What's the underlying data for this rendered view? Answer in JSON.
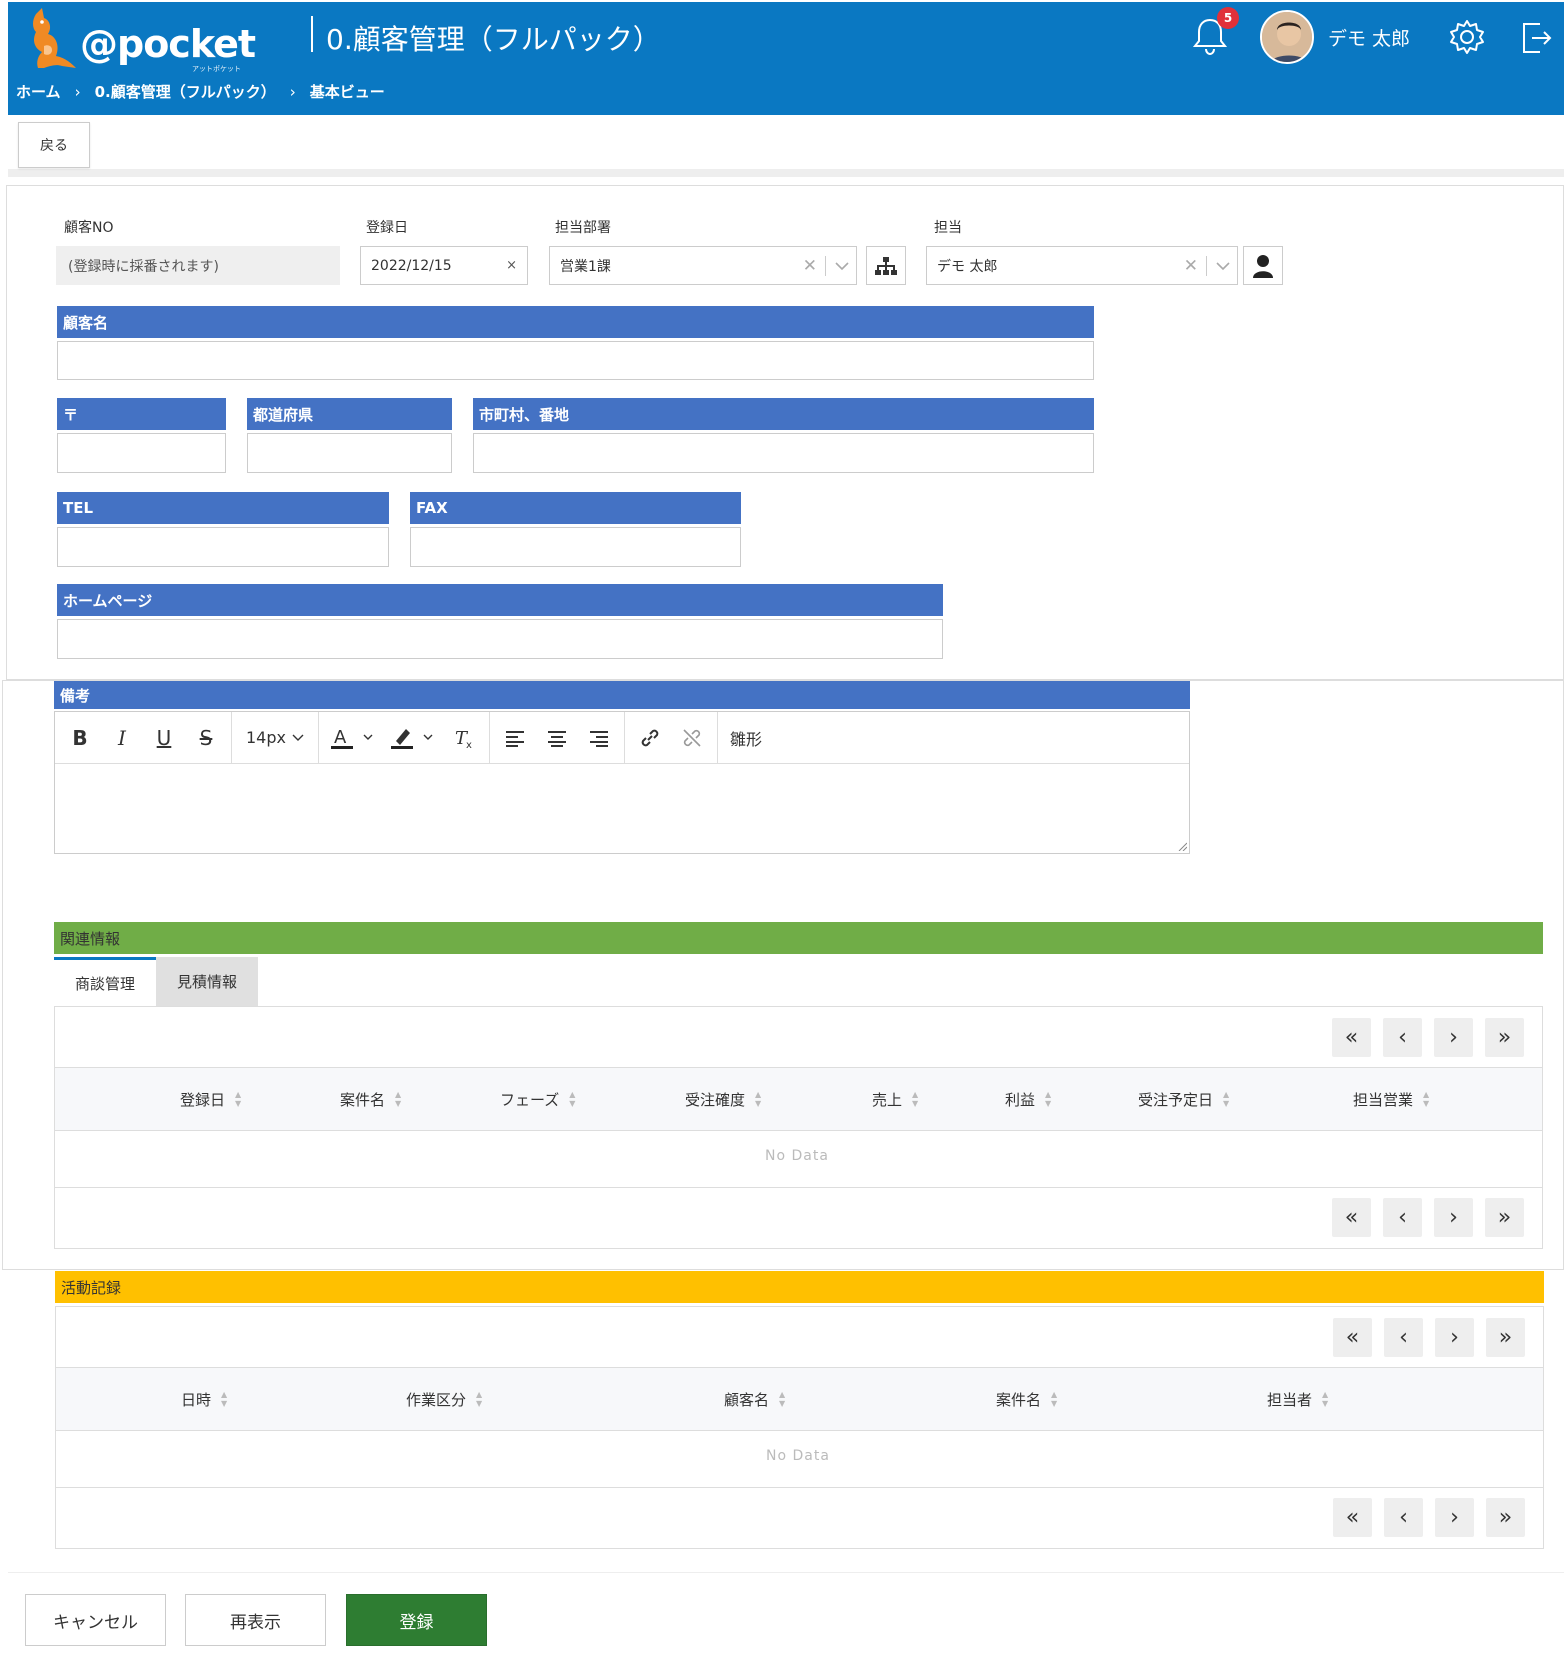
{
  "header": {
    "logo_text": "@pocket",
    "logo_sub": "アットポケット",
    "app_title": "0.顧客管理（フルパック）",
    "breadcrumb": [
      "ホーム",
      "0.顧客管理（フルパック）",
      "基本ビュー"
    ],
    "notification_count": "5",
    "user_name": "デモ 太郎",
    "colors": {
      "header_bg": "#0a78c2",
      "badge": "#e0313a"
    }
  },
  "toolbar": {
    "back_label": "戻る"
  },
  "form": {
    "customer_no": {
      "label": "顧客NO",
      "value": "(登録時に採番されます)"
    },
    "reg_date": {
      "label": "登録日",
      "value": "2022/12/15",
      "clear": "×"
    },
    "department": {
      "label": "担当部署",
      "value": "営業1課"
    },
    "owner": {
      "label": "担当",
      "value": "デモ 太郎"
    },
    "customer_name": {
      "label": "顧客名",
      "value": ""
    },
    "zip": {
      "label": "〒",
      "value": ""
    },
    "prefecture": {
      "label": "都道府県",
      "value": ""
    },
    "address": {
      "label": "市町村、番地",
      "value": ""
    },
    "tel": {
      "label": "TEL",
      "value": ""
    },
    "fax": {
      "label": "FAX",
      "value": ""
    },
    "homepage": {
      "label": "ホームページ",
      "value": ""
    },
    "notes": {
      "label": "備考",
      "value": ""
    }
  },
  "editor": {
    "font_size": "14px",
    "template_label": "雛形",
    "buttons": [
      "bold",
      "italic",
      "underline",
      "strikethrough",
      "font-color",
      "highlight",
      "clear-format",
      "align-left",
      "align-center",
      "align-right",
      "link",
      "unlink"
    ]
  },
  "related": {
    "title": "関連情報",
    "tabs": [
      {
        "label": "商談管理",
        "active": true
      },
      {
        "label": "見積情報",
        "active": false
      }
    ],
    "columns": [
      "登録日",
      "案件名",
      "フェーズ",
      "受注確度",
      "売上",
      "利益",
      "受注予定日",
      "担当営業"
    ],
    "empty_text": "No Data"
  },
  "activity": {
    "title": "活動記録",
    "columns": [
      "日時",
      "作業区分",
      "顧客名",
      "案件名",
      "担当者"
    ],
    "empty_text": "No Data"
  },
  "pager": {
    "first": "«",
    "prev": "‹",
    "next": "›",
    "last": "»"
  },
  "footer": {
    "cancel_label": "キャンセル",
    "refresh_label": "再表示",
    "submit_label": "登録"
  },
  "colors": {
    "section_blue": "#4472c4",
    "section_green": "#70ad47",
    "section_orange": "#ffc000",
    "primary_button": "#2e7d32"
  }
}
